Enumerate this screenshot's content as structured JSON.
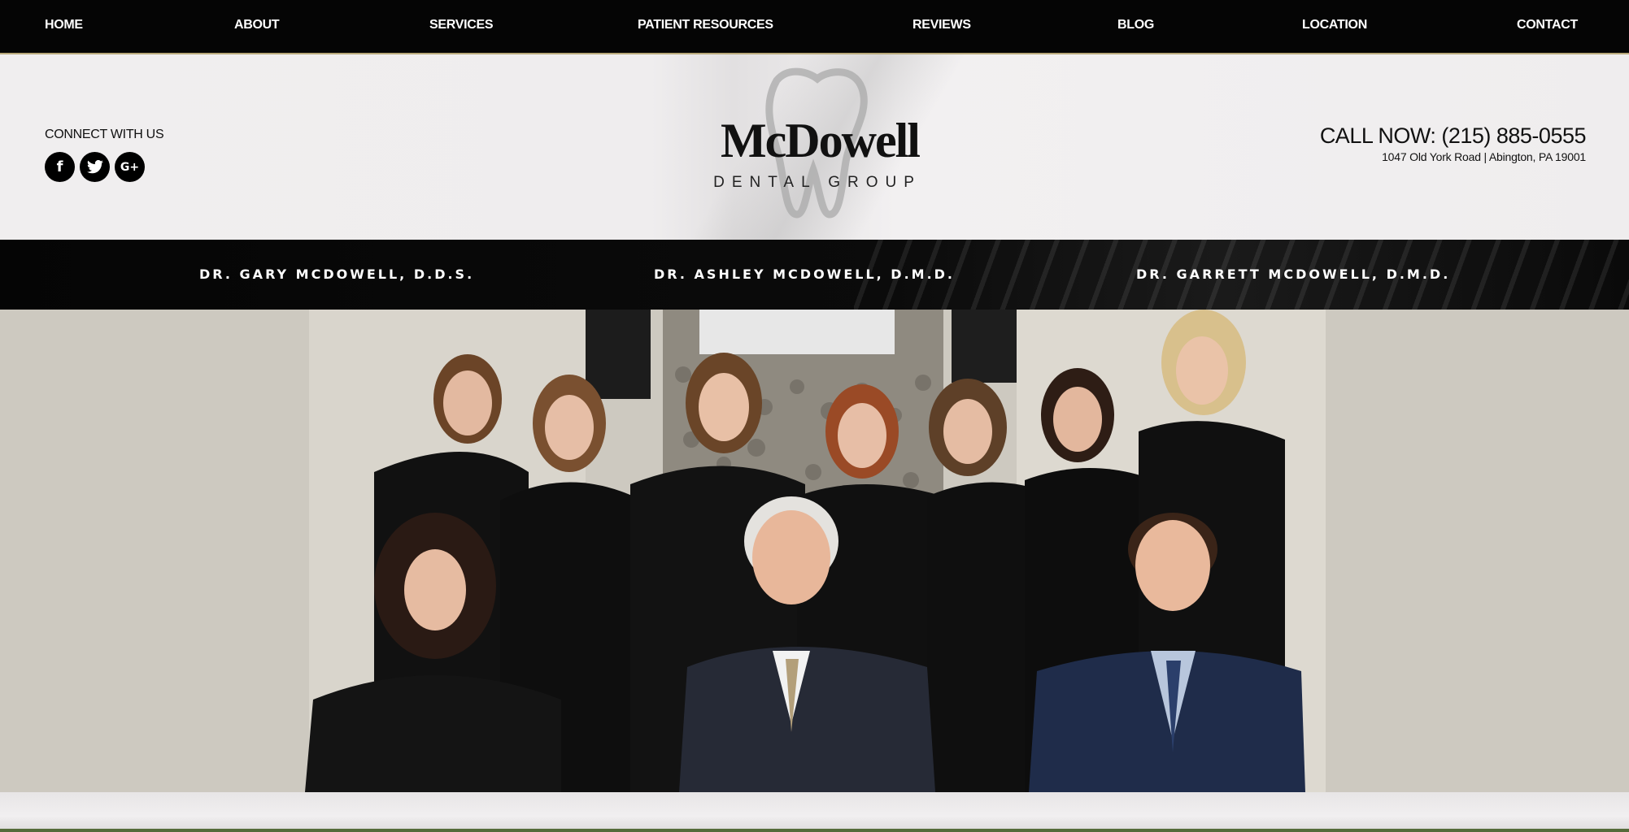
{
  "nav": {
    "items": [
      "HOME",
      "ABOUT",
      "SERVICES",
      "PATIENT RESOURCES",
      "REVIEWS",
      "BLOG",
      "LOCATION",
      "CONTACT"
    ]
  },
  "header": {
    "connect_label": "CONNECT WITH US",
    "social": [
      {
        "glyph": "f",
        "icon": "facebook-icon"
      },
      {
        "glyph": "t",
        "icon": "twitter-icon"
      },
      {
        "glyph": "G+",
        "icon": "google-plus-icon"
      }
    ],
    "logo_name": "McDowell",
    "logo_sub": "DENTAL GROUP",
    "call_now": "CALL NOW: (215) 885-0555",
    "address": "1047 Old York Road | Abington, PA 19001"
  },
  "doctors": [
    "DR. GARY MCDOWELL, D.D.S.",
    "DR. ASHLEY MCDOWELL, D.M.D.",
    "DR. GARRETT MCDOWELL, D.M.D."
  ],
  "colors": {
    "nav_bg": "#050505",
    "header_bg": "#f0eeef",
    "accent_gold": "#b9a97a",
    "photo_bg": "#cfcbc2"
  }
}
